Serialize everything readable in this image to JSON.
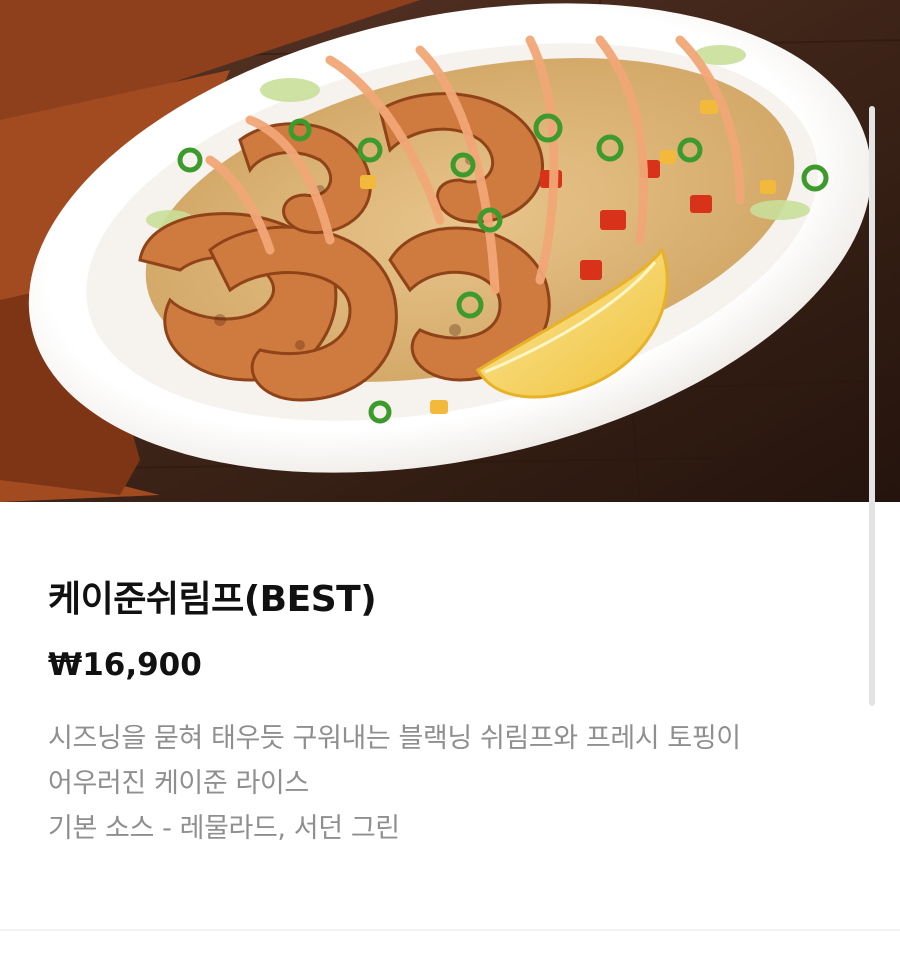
{
  "product": {
    "name": "케이준쉬림프(BEST)",
    "price": "₩16,900",
    "description_lines": [
      "시즈닝을 묻혀 태우듯 구워내는 블랙닝 쉬림프와 프레시 토핑이",
      "어우러진 케이준 라이스",
      "기본 소스 - 레물라드, 서던 그린"
    ]
  },
  "colors": {
    "background": "#ffffff",
    "title": "#111111",
    "description": "#8f8f8f"
  }
}
